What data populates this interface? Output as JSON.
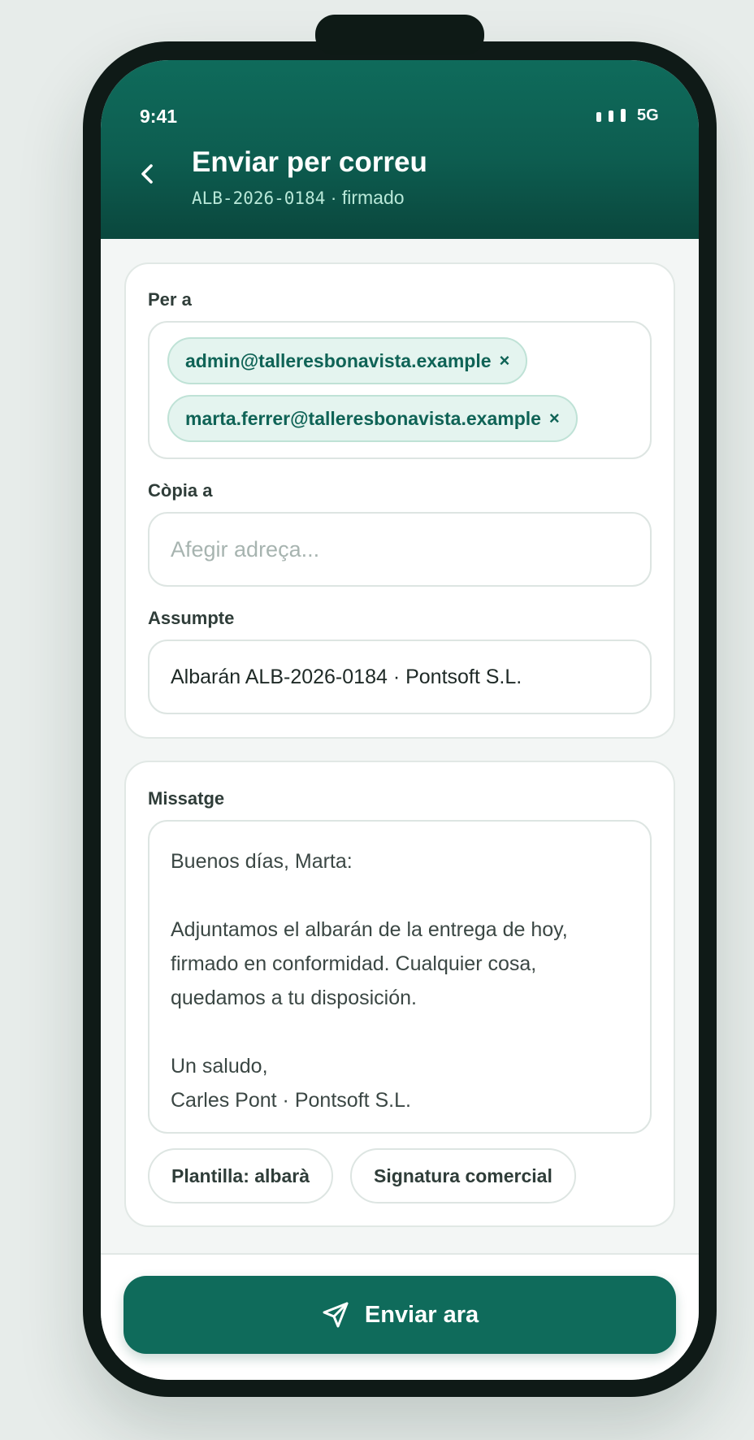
{
  "status_bar": {
    "time": "9:41",
    "network": "5G"
  },
  "header": {
    "title": "Enviar per correu",
    "doc_code": "ALB-2026-0184",
    "separator": " · ",
    "doc_status": "firmado"
  },
  "form": {
    "to_label": "Per a",
    "to_recipients": [
      "admin@talleresbonavista.example",
      "marta.ferrer@talleresbonavista.example"
    ],
    "remove_symbol": "×",
    "cc_label": "Còpia a",
    "cc_placeholder": "Afegir adreça...",
    "subject_label": "Assumpte",
    "subject_value": "Albarán ALB-2026-0184 · Pontsoft S.L."
  },
  "message": {
    "label": "Missatge",
    "lines": [
      "Buenos días, Marta:",
      "",
      "Adjuntamos el albarán de la entrega de hoy,",
      "firmado en conformidad. Cualquier cosa,",
      "quedamos a tu disposición.",
      "",
      "Un saludo,",
      "Carles Pont · Pontsoft S.L."
    ],
    "template_button": "Plantilla: albarà",
    "signature_button": "Signatura comercial"
  },
  "send_button": {
    "label": "Enviar ara",
    "icon": "send-icon"
  },
  "colors": {
    "brand": "#0f6b5b",
    "chip_bg": "#e4f4ef",
    "chip_text": "#0f6356"
  }
}
